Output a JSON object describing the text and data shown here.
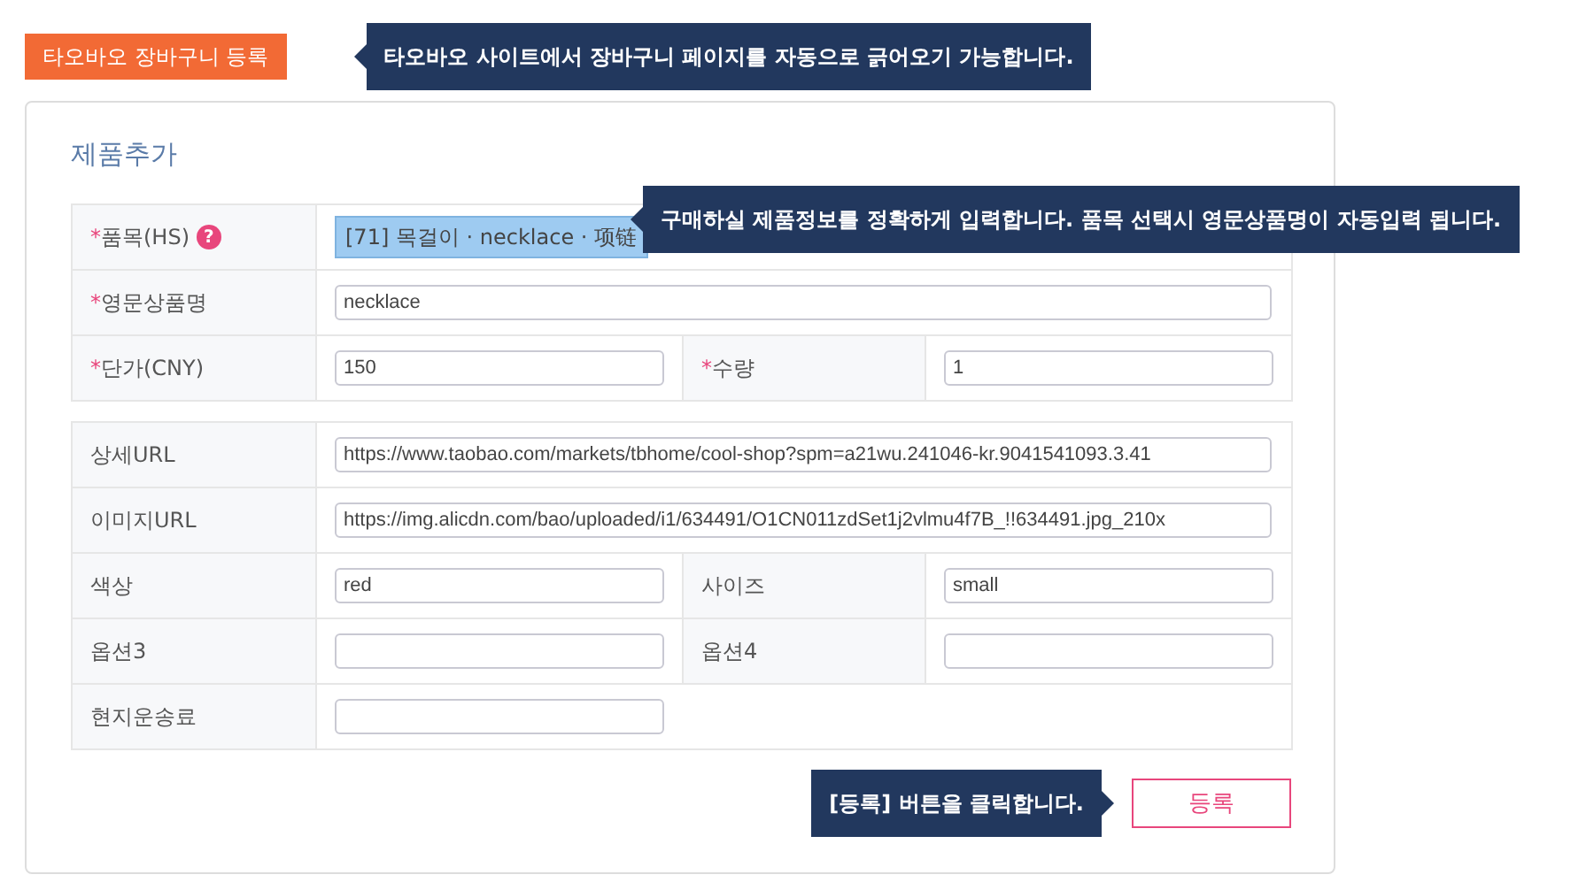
{
  "header": {
    "button": "타오바오 장바구니 등록",
    "tip": "타오바오 사이트에서 장바구니 페이지를 자동으로 긁어오기 가능합니다."
  },
  "panel": {
    "title": "제품추가",
    "sections": [
      {
        "rows": [
          {
            "pairs": [
              {
                "mark": "*",
                "label": "품목(HS)",
                "help": "?",
                "kind": "select",
                "value": "[71] 목걸이 · necklace · 项链"
              }
            ]
          },
          {
            "pairs": [
              {
                "mark": "*",
                "label": "영문상품명",
                "kind": "long",
                "value": "necklace"
              }
            ]
          },
          {
            "pairs": [
              {
                "mark": "*",
                "label": "단가(CNY)",
                "kind": "short",
                "value": "150"
              },
              {
                "mark": "*",
                "label": "수량",
                "kind": "short",
                "value": "1"
              }
            ]
          }
        ]
      },
      {
        "rows": [
          {
            "pairs": [
              {
                "label": "상세URL",
                "kind": "long",
                "value": "https://www.taobao.com/markets/tbhome/cool-shop?spm=a21wu.241046-kr.9041541093.3.41"
              }
            ]
          },
          {
            "pairs": [
              {
                "label": "이미지URL",
                "kind": "long",
                "value": "https://img.alicdn.com/bao/uploaded/i1/634491/O1CN011zdSet1j2vlmu4f7B_!!634491.jpg_210x"
              }
            ]
          },
          {
            "pairs": [
              {
                "label": "색상",
                "kind": "short",
                "value": "red"
              },
              {
                "label": "사이즈",
                "kind": "short",
                "value": "small"
              }
            ]
          },
          {
            "pairs": [
              {
                "label": "옵션3",
                "kind": "short"
              },
              {
                "label": "옵션4",
                "kind": "short"
              }
            ]
          },
          {
            "pairs": [
              {
                "label": "현지운송료",
                "kind": "short"
              }
            ]
          }
        ]
      }
    ],
    "tip": "구매하실 제품정보를 정확하게 입력합니다. 품목 선택시 영문상품명이 자동입력 됩니다.",
    "submit_tip": "[등록] 버튼을 클릭합니다.",
    "submit": "등록"
  }
}
